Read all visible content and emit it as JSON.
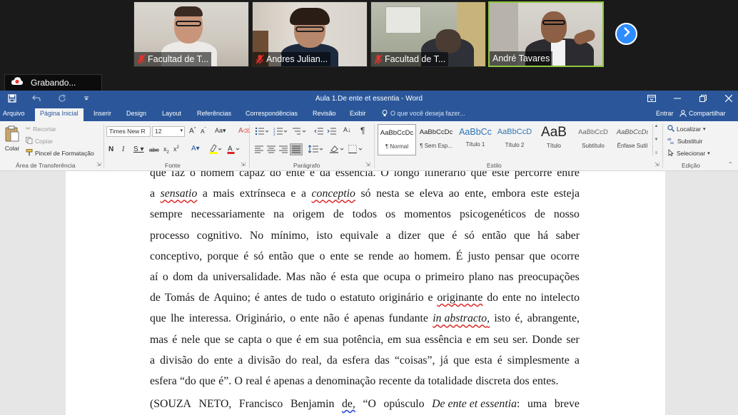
{
  "zoom": {
    "participants": [
      {
        "name": "Facultad de T...",
        "muted": true
      },
      {
        "name": "Andres Julian...",
        "muted": true
      },
      {
        "name": "Facultad de T...",
        "muted": true
      },
      {
        "name": "André Tavares",
        "muted": false,
        "active": true
      }
    ],
    "recording_label": "Grabando...",
    "accent_color": "#2d8cff",
    "active_speaker_color": "#8dc63f"
  },
  "word": {
    "window_title": "Aula 1.De ente et essentia - Word",
    "tabs": [
      "Arquivo",
      "Página Inicial",
      "Inserir",
      "Design",
      "Layout",
      "Referências",
      "Correspondências",
      "Revisão",
      "Exibir"
    ],
    "tell_me": "O que você deseja fazer...",
    "sign_in": "Entrar",
    "share": "Compartilhar",
    "clipboard": {
      "paste": "Colar",
      "cut": "Recortar",
      "copy": "Copiar",
      "format_painter": "Pincel de Formatação",
      "label": "Área de Transferência"
    },
    "font": {
      "name": "Times New R",
      "size": "12",
      "label": "Fonte"
    },
    "paragraph_label": "Parágrafo",
    "styles": {
      "label": "Estilo",
      "items": [
        {
          "sample": "AaBbCcDc",
          "name": "¶ Normal"
        },
        {
          "sample": "AaBbCcDc",
          "name": "¶ Sem Esp..."
        },
        {
          "sample": "AaBbCc",
          "name": "Título 1"
        },
        {
          "sample": "AaBbCcD",
          "name": "Título 2"
        },
        {
          "sample": "AaB",
          "name": "Título"
        },
        {
          "sample": "AaBbCcD",
          "name": "Subtítulo"
        },
        {
          "sample": "AaBbCcDı",
          "name": "Ênfase Sutil"
        }
      ]
    },
    "editing": {
      "find": "Localizar",
      "replace": "Substituir",
      "select": "Selecionar",
      "label": "Edição"
    },
    "brand_color": "#2b579a"
  },
  "document": {
    "lines": [
      [
        {
          "t": "que faz o homem capaz do ente e da essência. O longo itinerário que este percorre entre"
        }
      ],
      [
        {
          "t": "a"
        },
        {
          "t": "sensatio",
          "s": "it sq"
        },
        {
          "t": "a mais extrínseca e a"
        },
        {
          "t": "conceptio",
          "s": "it sq"
        },
        {
          "t": "só nesta se eleva ao ente, embora este esteja"
        }
      ],
      [
        {
          "t": "sempre necessariamente na origem de todos os momentos psicogenéticos de nosso"
        }
      ],
      [
        {
          "t": "processo cognitivo. No mínimo, isto equivale a dizer que é só então que há saber"
        }
      ],
      [
        {
          "t": "conceptivo, porque é só então que o ente se rende ao homem. É justo pensar que ocorre"
        }
      ],
      [
        {
          "t": "aí o dom da universalidade. Mas não é esta que ocupa o primeiro plano nas preocupações"
        }
      ],
      [
        {
          "t": "de Tomás de Aquino; é antes de tudo o estatuto originário e"
        },
        {
          "t": "originante",
          "s": "sq"
        },
        {
          "t": "do ente no intelecto"
        }
      ],
      [
        {
          "t": "que lhe interessa. Originário, o ente não é apenas fundante"
        },
        {
          "t": "in abstracto",
          "s": "it sq"
        },
        {
          "t": ", isto é, abrangente,"
        }
      ],
      [
        {
          "t": "mas é nele que se capta o que é em sua potência, em sua essência e em seu ser. Donde ser"
        }
      ],
      [
        {
          "t": "a divisão do ente a divisão do real, da esfera das “coisas”, já que esta é simplesmente a"
        }
      ],
      [
        {
          "t": "esfera “do que é”. O real é apenas a denominação recente da totalidade discreta dos entes."
        }
      ]
    ],
    "citation": [
      {
        "t": "(SOUZA NETO, Francisco Benjamin"
      },
      {
        "t": "de,",
        "s": "sqb"
      },
      {
        "t": "“O opúsculo"
      },
      {
        "t": "De ente et essentia",
        "s": "it"
      },
      {
        "t": ": uma breve"
      }
    ]
  }
}
